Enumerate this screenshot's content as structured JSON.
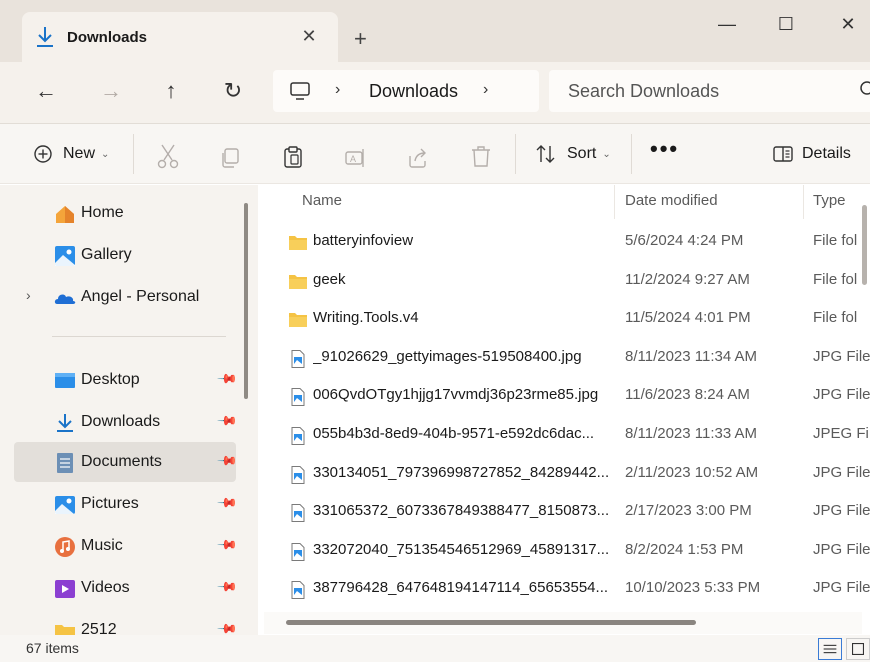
{
  "window": {
    "tab_title": "Downloads",
    "tab_close": "✕",
    "new_tab": "+",
    "minimize": "—",
    "maximize": "☐",
    "close": "✕"
  },
  "nav": {
    "back": "←",
    "forward": "→",
    "up": "↑",
    "refresh": "↻",
    "breadcrumb_sep": "›",
    "breadcrumb": "Downloads",
    "search_placeholder": "Search Downloads"
  },
  "toolbar": {
    "new_label": "New",
    "sort_label": "Sort",
    "more_label": "•••",
    "details_label": "Details",
    "caret": "⌄"
  },
  "sidebar": {
    "expand": "›",
    "pin": "📌",
    "items": [
      {
        "label": "Home",
        "icon": "home-icon"
      },
      {
        "label": "Gallery",
        "icon": "gallery-icon"
      },
      {
        "label": "Angel - Personal",
        "icon": "onedrive-icon"
      },
      {
        "label": "Desktop",
        "icon": "desktop-icon"
      },
      {
        "label": "Downloads",
        "icon": "downloads-icon"
      },
      {
        "label": "Documents",
        "icon": "documents-icon"
      },
      {
        "label": "Pictures",
        "icon": "pictures-icon"
      },
      {
        "label": "Music",
        "icon": "music-icon"
      },
      {
        "label": "Videos",
        "icon": "videos-icon"
      },
      {
        "label": "2512",
        "icon": "folder-icon"
      }
    ]
  },
  "columns": {
    "name": "Name",
    "date": "Date modified",
    "type": "Type"
  },
  "files": [
    {
      "name": "batteryinfoview",
      "date": "5/6/2024 4:24 PM",
      "type": "File fol",
      "kind": "folder"
    },
    {
      "name": "geek",
      "date": "11/2/2024 9:27 AM",
      "type": "File fol",
      "kind": "folder"
    },
    {
      "name": "Writing.Tools.v4",
      "date": "11/5/2024 4:01 PM",
      "type": "File fol",
      "kind": "folder"
    },
    {
      "name": "_91026629_gettyimages-519508400.jpg",
      "date": "8/11/2023 11:34 AM",
      "type": "JPG File",
      "kind": "image"
    },
    {
      "name": "006QvdOTgy1hjjg17vvmdj36p23rme85.jpg",
      "date": "11/6/2023 8:24 AM",
      "type": "JPG File",
      "kind": "image"
    },
    {
      "name": "055b4b3d-8ed9-404b-9571-e592dc6dac...",
      "date": "8/11/2023 11:33 AM",
      "type": "JPEG Fi",
      "kind": "image"
    },
    {
      "name": "330134051_797396998727852_84289442...",
      "date": "2/11/2023 10:52 AM",
      "type": "JPG File",
      "kind": "image"
    },
    {
      "name": "331065372_6073367849388477_8150873...",
      "date": "2/17/2023 3:00 PM",
      "type": "JPG File",
      "kind": "image"
    },
    {
      "name": "332072040_751354546512969_45891317...",
      "date": "8/2/2024 1:53 PM",
      "type": "JPG File",
      "kind": "image"
    },
    {
      "name": "387796428_647648194147114_65653554...",
      "date": "10/10/2023 5:33 PM",
      "type": "JPG File",
      "kind": "image"
    }
  ],
  "status": {
    "item_count": "67 items"
  },
  "colors": {
    "accent": "#0067c0",
    "folder": "#f5c344",
    "titlebar": "#e9e3dc",
    "selected": "#e3dfda"
  }
}
